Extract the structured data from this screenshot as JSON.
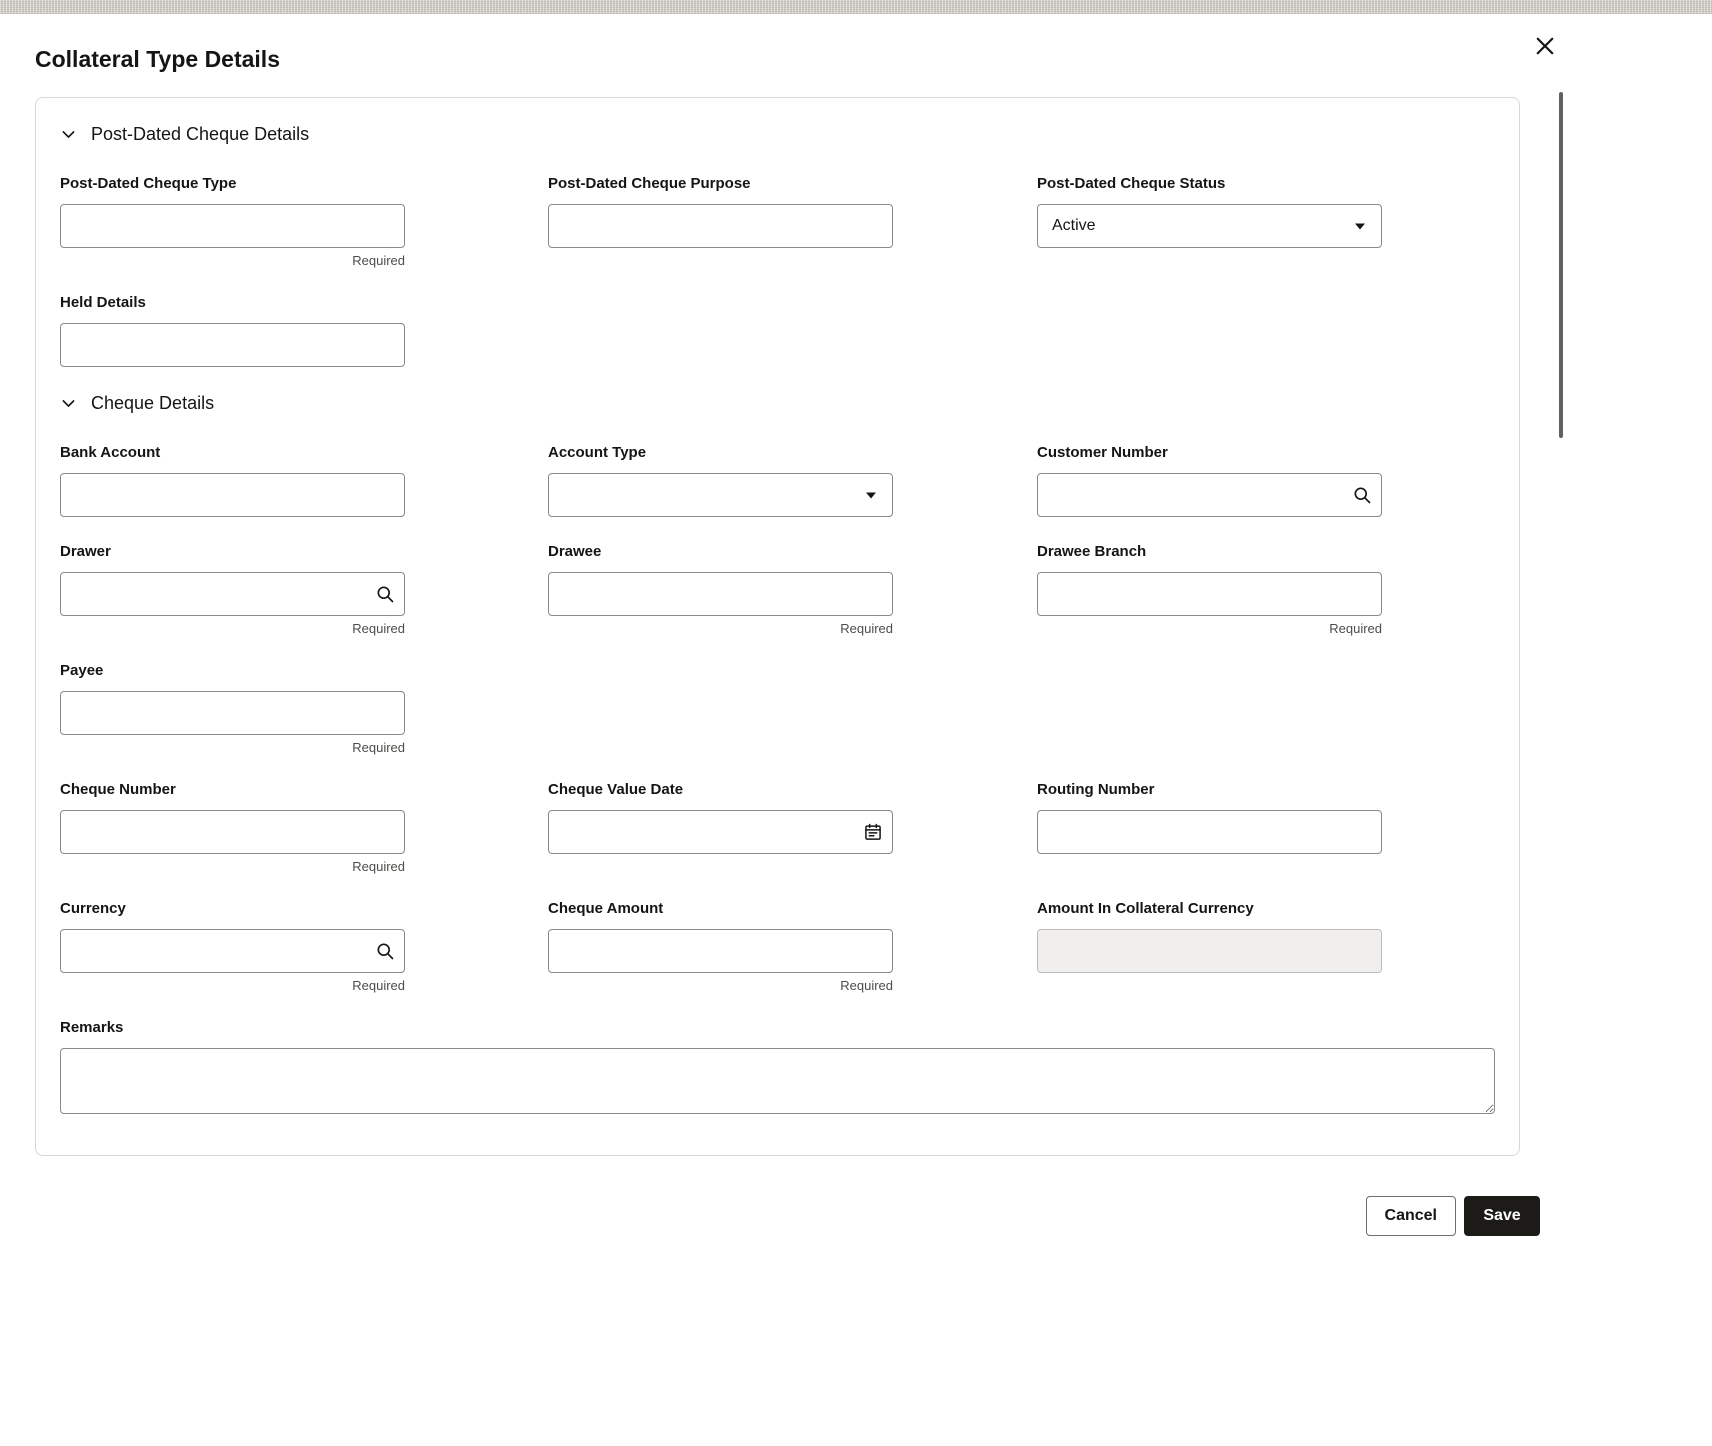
{
  "window": {
    "title": "Collateral Type Details"
  },
  "icons": {
    "close": "✕",
    "section_chevron": "chevron-down",
    "search": "magnifier",
    "calendar": "calendar",
    "select_caret": "caret-down",
    "textarea_resize": "resize-grip"
  },
  "colors": {
    "save_button_bg": "#1c1b17",
    "input_border": "#8b8a88",
    "panel_border": "#d9d7d2",
    "required_text": "#4f4d49",
    "disabled_input_bg": "#f0efed"
  },
  "sections": {
    "post_dated": {
      "title": "Post-Dated Cheque Details",
      "fields": {
        "type": {
          "label": "Post-Dated Cheque Type",
          "value": "",
          "required": "Required"
        },
        "purpose": {
          "label": "Post-Dated Cheque Purpose",
          "value": ""
        },
        "status": {
          "label": "Post-Dated Cheque Status",
          "value": "Active"
        },
        "held_details": {
          "label": "Held Details",
          "value": ""
        }
      }
    },
    "cheque": {
      "title": "Cheque Details",
      "fields": {
        "bank_account": {
          "label": "Bank Account",
          "value": ""
        },
        "account_type": {
          "label": "Account Type",
          "value": ""
        },
        "customer_number": {
          "label": "Customer Number",
          "value": ""
        },
        "drawer": {
          "label": "Drawer",
          "value": "",
          "required": "Required"
        },
        "drawee": {
          "label": "Drawee",
          "value": "",
          "required": "Required"
        },
        "drawee_branch": {
          "label": "Drawee Branch",
          "value": "",
          "required": "Required"
        },
        "payee": {
          "label": "Payee",
          "value": "",
          "required": "Required"
        },
        "cheque_number": {
          "label": "Cheque Number",
          "value": "",
          "required": "Required"
        },
        "cheque_value_date": {
          "label": "Cheque Value Date",
          "value": ""
        },
        "routing_number": {
          "label": "Routing Number",
          "value": ""
        },
        "currency": {
          "label": "Currency",
          "value": "",
          "required": "Required"
        },
        "cheque_amount": {
          "label": "Cheque Amount",
          "value": "",
          "required": "Required"
        },
        "amount_in_collateral_currency": {
          "label": "Amount In Collateral Currency",
          "value": ""
        },
        "remarks": {
          "label": "Remarks",
          "value": ""
        }
      }
    }
  },
  "footer": {
    "cancel_label": "Cancel",
    "save_label": "Save"
  }
}
